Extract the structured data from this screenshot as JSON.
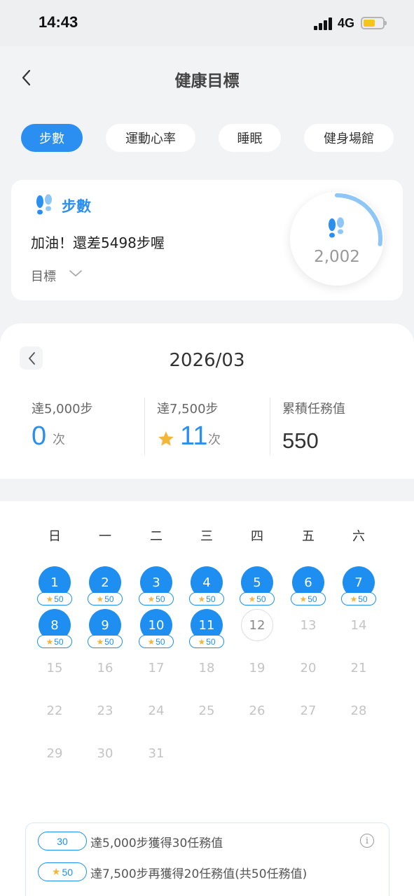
{
  "status_bar": {
    "time": "14:43",
    "network": "4G",
    "battery_level": 0.5,
    "battery_color": "#f5c518"
  },
  "header": {
    "title": "健康目標",
    "back_icon": "chevron-left-icon"
  },
  "tabs": [
    {
      "label": "步數",
      "active": true
    },
    {
      "label": "運動心率",
      "active": false
    },
    {
      "label": "睡眠",
      "active": false
    },
    {
      "label": "健身場館",
      "active": false
    }
  ],
  "summary_card": {
    "icon": "footsteps-icon",
    "title": "步數",
    "message": "加油！還差5498步喔",
    "goal_label": "目標",
    "ring_value": "2,002",
    "ring_progress": 0.27
  },
  "month": {
    "label": "2026/03",
    "stats": [
      {
        "label": "達5,000步",
        "value": "0",
        "unit": "次",
        "star": false
      },
      {
        "label": "達7,500步",
        "value": "11",
        "unit": "次",
        "star": true
      },
      {
        "label": "累積任務值",
        "value": "550",
        "unit": "",
        "star": false
      }
    ]
  },
  "calendar": {
    "weekdays": [
      "日",
      "一",
      "二",
      "三",
      "四",
      "五",
      "六"
    ],
    "first_weekday": 0,
    "days": 31,
    "completed_days": [
      1,
      2,
      3,
      4,
      5,
      6,
      7,
      8,
      9,
      10,
      11
    ],
    "today": 12,
    "reward_label": "50"
  },
  "legend": {
    "items": [
      {
        "pill": "30",
        "star": false,
        "text": "達5,000步獲得30任務值"
      },
      {
        "pill": "50",
        "star": true,
        "text": "達7,500步再獲得20任務值(共50任務值)"
      }
    ],
    "info_icon": "info-icon",
    "info_glyph": "i"
  },
  "colors": {
    "accent": "#2a8ff0",
    "star": "#f4b63a"
  }
}
